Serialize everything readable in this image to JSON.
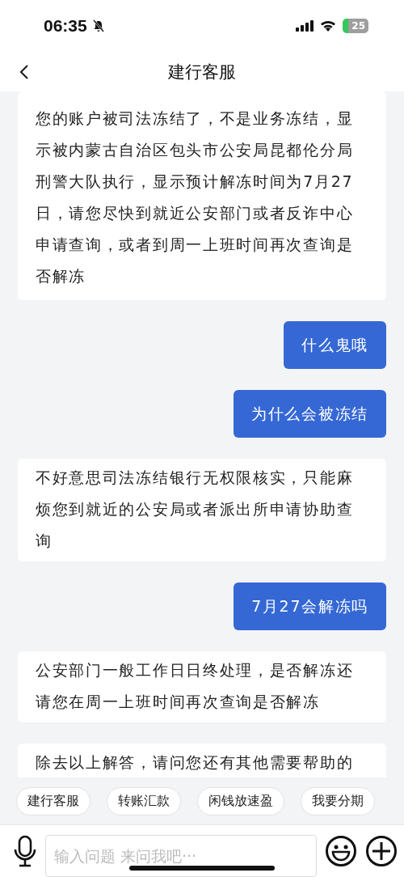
{
  "status_bar": {
    "time": "06:35",
    "battery": "25"
  },
  "header": {
    "title": "建行客服"
  },
  "messages": [
    {
      "kind": "bot",
      "text": "您的账户被司法冻结了，不是业务冻结，显示被内蒙古自治区包头市公安局昆都伦分局刑警大队执行，显示预计解冻时间为7月27日，请您尽快到就近公安部门或者反诈中心申请查询，或者到周一上班时间再次查询是否解冻"
    },
    {
      "kind": "user",
      "text": "什么鬼哦"
    },
    {
      "kind": "user",
      "text": "为什么会被冻结"
    },
    {
      "kind": "bot",
      "text": "不好意思司法冻结银行无权限核实，只能麻烦您到就近的公安局或者派出所申请协助查询"
    },
    {
      "kind": "user",
      "text": "7月27会解冻吗"
    },
    {
      "kind": "bot",
      "text": "公安部门一般工作日日终处理，是否解冻还请您在周一上班时间再次查询是否解冻"
    },
    {
      "kind": "bot",
      "text": "除去以上解答，请问您还有其他需要帮助的"
    }
  ],
  "quick_replies": [
    "建行客服",
    "转账汇款",
    "闲钱放速盈",
    "我要分期"
  ],
  "input": {
    "placeholder": "输入问题 来问我吧···"
  }
}
